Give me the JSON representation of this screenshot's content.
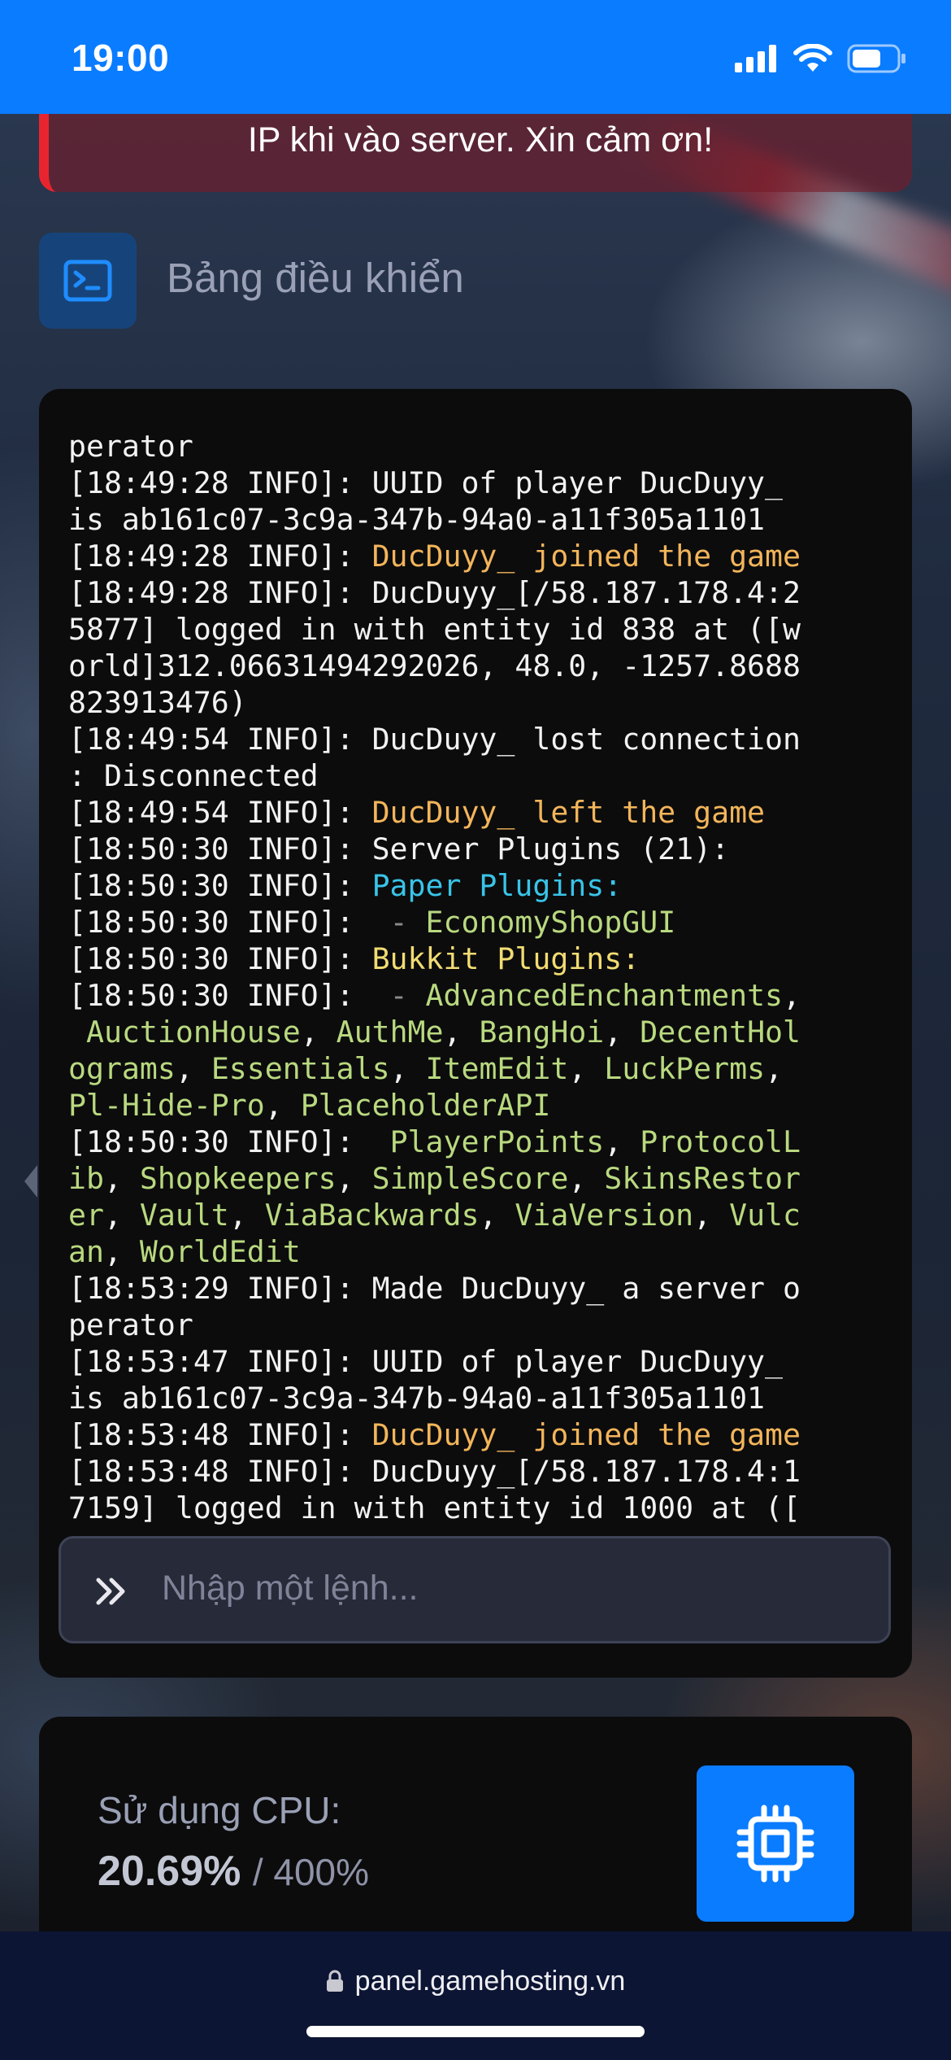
{
  "status_bar": {
    "time": "19:00"
  },
  "alert": {
    "text": "IP khi vào server. Xin cảm ơn!"
  },
  "header": {
    "title": "Bảng điều khiển",
    "icon": "terminal-icon"
  },
  "console": {
    "lines": [
      [
        {
          "t": "perator"
        }
      ],
      [
        {
          "t": "[18:49:28 INFO]: UUID of player DucDuyy_"
        }
      ],
      [
        {
          "t": "is ab161c07-3c9a-347b-94a0-a11f305a1101"
        }
      ],
      [
        {
          "t": "[18:49:28 INFO]: "
        },
        {
          "t": "DucDuyy_ joined the game",
          "c": "orange"
        }
      ],
      [
        {
          "t": "[18:49:28 INFO]: DucDuyy_[/58.187.178.4:2"
        }
      ],
      [
        {
          "t": "5877] logged in with entity id 838 at ([w"
        }
      ],
      [
        {
          "t": "orld]312.06631494292026, 48.0, -1257.8688"
        }
      ],
      [
        {
          "t": "823913476)"
        }
      ],
      [
        {
          "t": "[18:49:54 INFO]: DucDuyy_ lost connection"
        }
      ],
      [
        {
          "t": ": Disconnected"
        }
      ],
      [
        {
          "t": "[18:49:54 INFO]: "
        },
        {
          "t": "DucDuyy_ left the game",
          "c": "orange"
        }
      ],
      [
        {
          "t": "[18:50:30 INFO]: Server Plugins (21):"
        }
      ],
      [
        {
          "t": "[18:50:30 INFO]: "
        },
        {
          "t": "Paper Plugins:",
          "c": "cyan"
        }
      ],
      [
        {
          "t": "[18:50:30 INFO]:  "
        },
        {
          "t": "- ",
          "c": "dash"
        },
        {
          "t": "EconomyShopGUI",
          "c": "green"
        }
      ],
      [
        {
          "t": "[18:50:30 INFO]: "
        },
        {
          "t": "Bukkit Plugins:",
          "c": "yellow"
        }
      ],
      [
        {
          "t": "[18:50:30 INFO]:  "
        },
        {
          "t": "- ",
          "c": "dash"
        },
        {
          "t": "AdvancedEnchantments",
          "c": "green"
        },
        {
          "t": ","
        }
      ],
      [
        {
          "t": " AuctionHouse",
          "c": "green"
        },
        {
          "t": ", "
        },
        {
          "t": "AuthMe",
          "c": "green"
        },
        {
          "t": ", "
        },
        {
          "t": "BangHoi",
          "c": "green"
        },
        {
          "t": ", "
        },
        {
          "t": "DecentHol",
          "c": "green"
        }
      ],
      [
        {
          "t": "ograms",
          "c": "green"
        },
        {
          "t": ", "
        },
        {
          "t": "Essentials",
          "c": "green"
        },
        {
          "t": ", "
        },
        {
          "t": "ItemEdit",
          "c": "green"
        },
        {
          "t": ", "
        },
        {
          "t": "LuckPerms",
          "c": "green"
        },
        {
          "t": ","
        }
      ],
      [
        {
          "t": "Pl-Hide-Pro",
          "c": "green"
        },
        {
          "t": ", "
        },
        {
          "t": "PlaceholderAPI",
          "c": "green"
        }
      ],
      [
        {
          "t": "[18:50:30 INFO]:  "
        },
        {
          "t": "PlayerPoints",
          "c": "green"
        },
        {
          "t": ", "
        },
        {
          "t": "ProtocolL",
          "c": "green"
        }
      ],
      [
        {
          "t": "ib",
          "c": "green"
        },
        {
          "t": ", "
        },
        {
          "t": "Shopkeepers",
          "c": "green"
        },
        {
          "t": ", "
        },
        {
          "t": "SimpleScore",
          "c": "green"
        },
        {
          "t": ", "
        },
        {
          "t": "SkinsRestor",
          "c": "green"
        }
      ],
      [
        {
          "t": "er",
          "c": "green"
        },
        {
          "t": ", "
        },
        {
          "t": "Vault",
          "c": "green"
        },
        {
          "t": ", "
        },
        {
          "t": "ViaBackwards",
          "c": "green"
        },
        {
          "t": ", "
        },
        {
          "t": "ViaVersion",
          "c": "green"
        },
        {
          "t": ", "
        },
        {
          "t": "Vulc",
          "c": "green"
        }
      ],
      [
        {
          "t": "an",
          "c": "green"
        },
        {
          "t": ", "
        },
        {
          "t": "WorldEdit",
          "c": "green"
        }
      ],
      [
        {
          "t": "[18:53:29 INFO]: Made DucDuyy_ a server o"
        }
      ],
      [
        {
          "t": "perator"
        }
      ],
      [
        {
          "t": "[18:53:47 INFO]: UUID of player DucDuyy_"
        }
      ],
      [
        {
          "t": "is ab161c07-3c9a-347b-94a0-a11f305a1101"
        }
      ],
      [
        {
          "t": "[18:53:48 INFO]: "
        },
        {
          "t": "DucDuyy_ joined the game",
          "c": "orange"
        }
      ],
      [
        {
          "t": "[18:53:48 INFO]: DucDuyy_[/58.187.178.4:1"
        }
      ],
      [
        {
          "t": "7159] logged in with entity id 1000 at (["
        }
      ]
    ],
    "command_placeholder": "Nhập một lệnh...",
    "colors": {
      "orange": "#f3b55a",
      "cyan": "#39c4e8",
      "yellow": "#f1dc72",
      "green": "#b9d97f"
    }
  },
  "cpu": {
    "label": "Sử dụng CPU:",
    "value": "20.69%",
    "max": "/ 400%",
    "icon": "cpu-chip-icon"
  },
  "browser": {
    "url": "panel.gamehosting.vn"
  },
  "theme": {
    "accent": "#0a7cff",
    "alert": "#e8252f"
  }
}
